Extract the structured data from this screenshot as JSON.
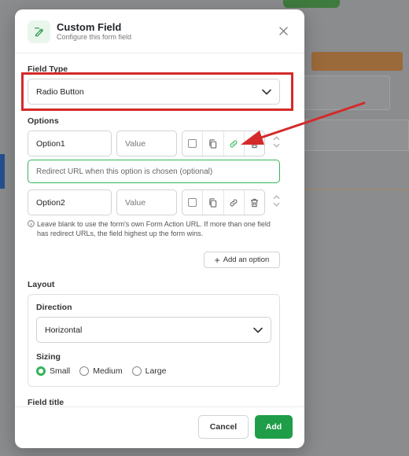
{
  "modal": {
    "title": "Custom Field",
    "subtitle": "Configure this form field"
  },
  "field_type": {
    "label": "Field Type",
    "value": "Radio Button"
  },
  "options": {
    "label": "Options",
    "items": [
      {
        "label": "Option1",
        "value_placeholder": "Value"
      },
      {
        "label": "Option2",
        "value_placeholder": "Value"
      }
    ],
    "redirect_placeholder": "Redirect URL when this option is chosen (optional)",
    "help_text": "Leave blank to use the form's own Form Action URL. If more than one field has redirect URLs, the field highest up the form wins.",
    "add_label": "Add an option"
  },
  "layout": {
    "label": "Layout",
    "direction_label": "Direction",
    "direction_value": "Horizontal",
    "sizing_label": "Sizing",
    "sizing_options": [
      "Small",
      "Medium",
      "Large"
    ],
    "sizing_selected": "Small"
  },
  "field_title": {
    "label": "Field title"
  },
  "footer": {
    "cancel_label": "Cancel",
    "add_label": "Add"
  },
  "colors": {
    "accent": "#1f9d48",
    "annotation": "#d42a2a"
  }
}
